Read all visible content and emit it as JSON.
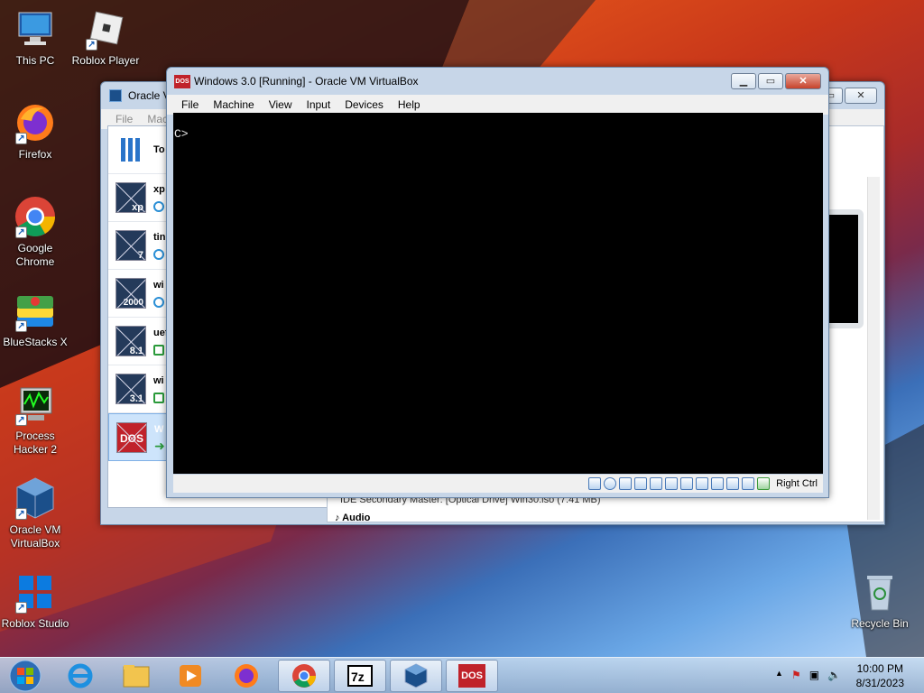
{
  "desktop": {
    "icons": [
      {
        "label": "This PC",
        "icon": "computer-icon"
      },
      {
        "label": "Roblox Player",
        "icon": "roblox-icon"
      },
      {
        "label": "Firefox",
        "icon": "firefox-icon"
      },
      {
        "label": "Google Chrome",
        "icon": "chrome-icon"
      },
      {
        "label": "BlueStacks X",
        "icon": "bluestacks-icon"
      },
      {
        "label": "Process Hacker 2",
        "icon": "process-hacker-icon"
      },
      {
        "label": "Oracle VM VirtualBox",
        "icon": "virtualbox-icon"
      },
      {
        "label": "Roblox Studio",
        "icon": "roblox-studio-icon"
      },
      {
        "label": "Recycle Bin",
        "icon": "recycle-bin-icon"
      }
    ]
  },
  "manager": {
    "title": "Oracle V",
    "menu": [
      "File",
      "Mac"
    ],
    "tools_label": "To",
    "vms": [
      {
        "name": "xp",
        "badge": "xp"
      },
      {
        "name": "tin",
        "badge": "7"
      },
      {
        "name": "wi",
        "badge": "2000"
      },
      {
        "name": "uef",
        "badge": "8.1"
      },
      {
        "name": "wi",
        "badge": "3.1"
      },
      {
        "name": "W",
        "badge": "DOS"
      }
    ],
    "detail_text": "IDE Secondary Master:     [Optical Drive] Win30.iso (7.41 MB)",
    "detail_section": "Audio"
  },
  "vm": {
    "title": "Windows 3.0 [Running] - Oracle VM VirtualBox",
    "title_badge": "DOS",
    "menu": [
      "File",
      "Machine",
      "View",
      "Input",
      "Devices",
      "Help"
    ],
    "prompt": "C>",
    "host_key": "Right Ctrl"
  },
  "taskbar": {
    "time": "10:00 PM",
    "date": "8/31/2023",
    "tray_arrow": "▲"
  }
}
